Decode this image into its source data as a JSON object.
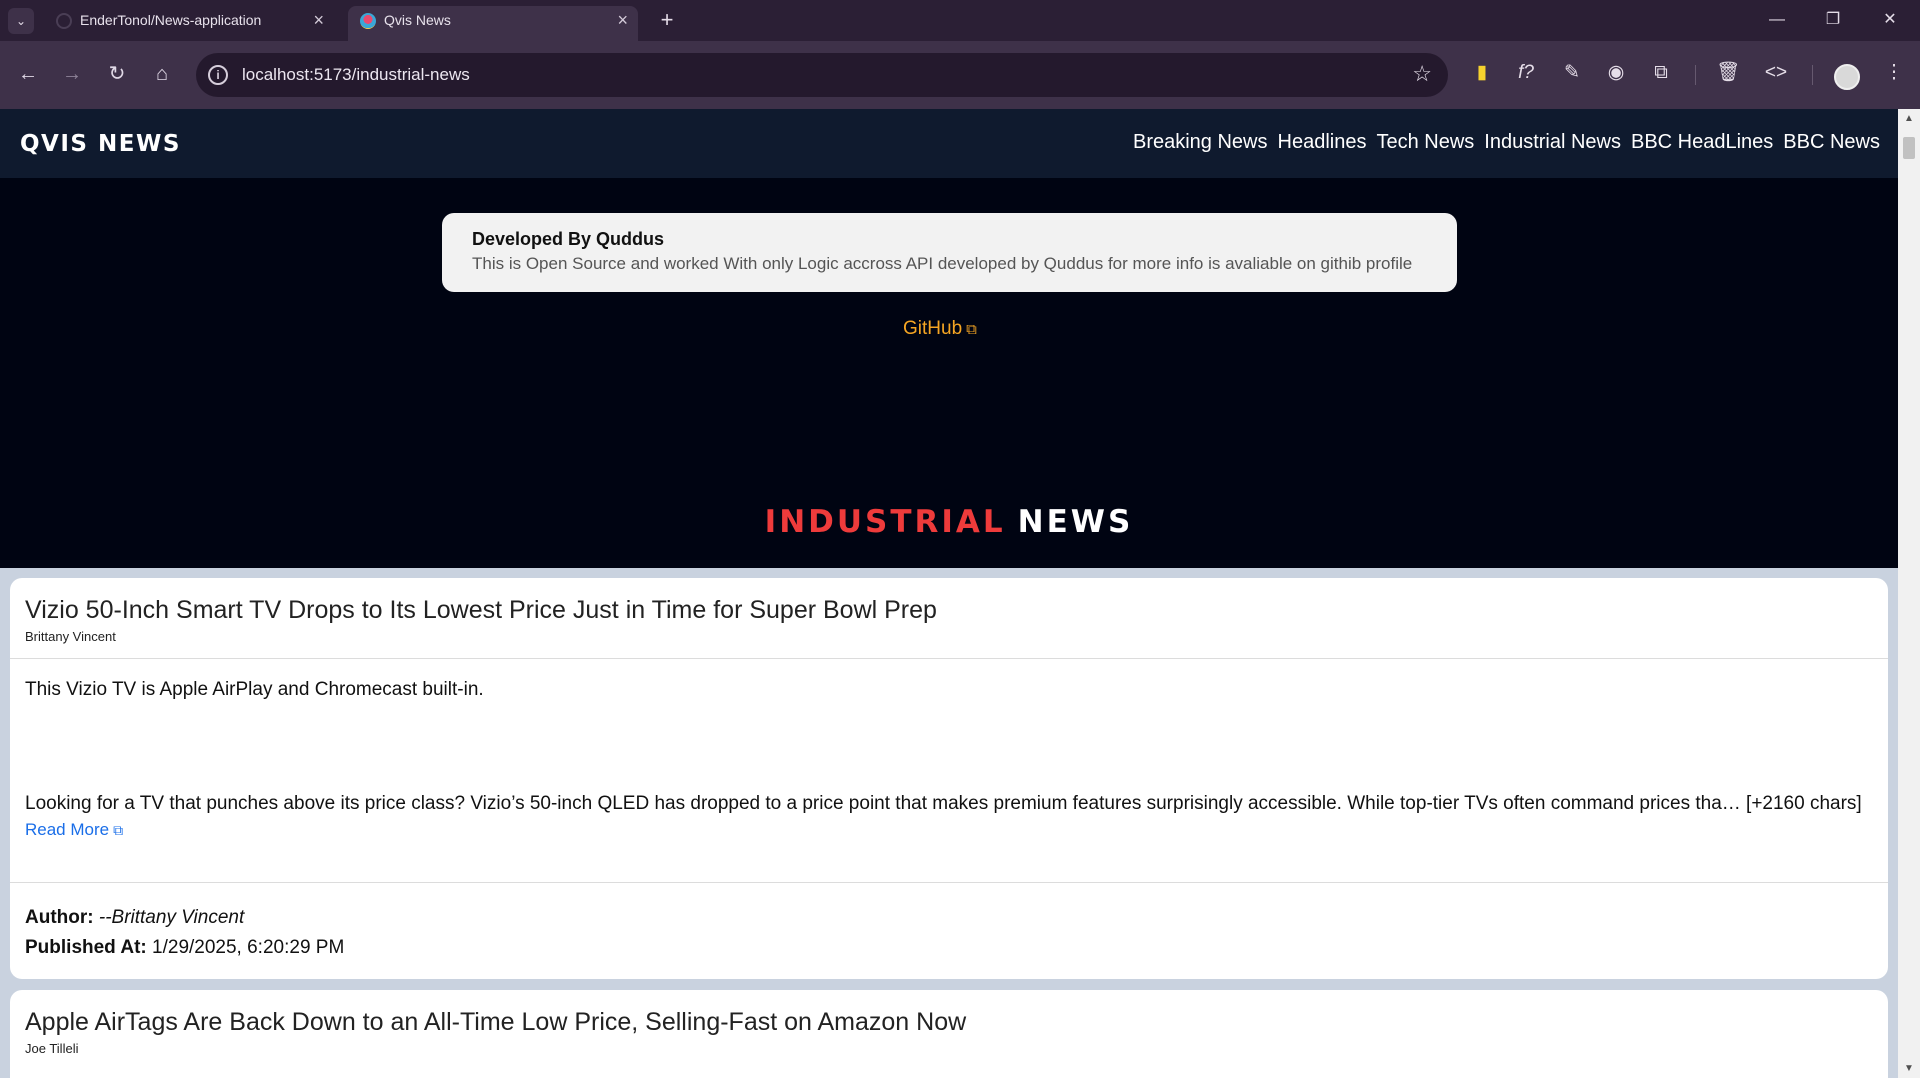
{
  "browser": {
    "tabs": [
      {
        "title": "EnderTonol/News-application",
        "active": false
      },
      {
        "title": "Qvis News",
        "active": true
      }
    ],
    "url": "localhost:5173/industrial-news"
  },
  "site": {
    "brand": "QVIS NEWS",
    "nav": [
      "Breaking News",
      "Headlines",
      "Tech News",
      "Industrial News",
      "BBC HeadLines",
      "BBC News"
    ]
  },
  "developer_card": {
    "title": "Developed By Quddus",
    "text": "This is Open Source and worked With only Logic accross API developed by Quddus for more info is avaliable on githib profile"
  },
  "github_link": "GitHub",
  "section": {
    "title_red": "INDUSTRIAL",
    "title_white": "NEWS"
  },
  "articles": [
    {
      "title": "Vizio 50-Inch Smart TV Drops to Its Lowest Price Just in Time for Super Bowl Prep",
      "author_short": "Brittany Vincent",
      "description": "This Vizio TV is Apple AirPlay and Chromecast built-in.",
      "content": "Looking for a TV that punches above its price class? Vizio’s 50-inch QLED has dropped to a price point that makes premium features surprisingly accessible. While top-tier TVs often command prices tha… [+2160 chars]",
      "read_more": "Read More",
      "author_label": "Author:",
      "author_value": "--Brittany Vincent",
      "published_label": "Published At:",
      "published_value": "1/29/2025, 6:20:29 PM"
    },
    {
      "title": "Apple AirTags Are Back Down to an All-Time Low Price, Selling-Fast on Amazon Now",
      "author_short": "Joe Tilleli"
    }
  ]
}
